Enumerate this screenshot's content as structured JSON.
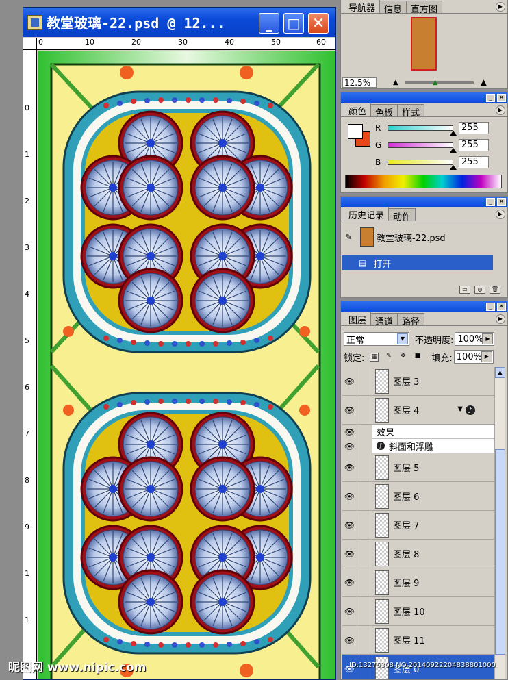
{
  "document": {
    "title": "教堂玻璃-22.psd @ 12...",
    "buttons": {
      "minimize": "_",
      "maximize": "□",
      "close": "✕"
    },
    "ruler_h": [
      "0",
      "10",
      "20",
      "30",
      "40",
      "50",
      "60"
    ],
    "ruler_v": [
      "0",
      "1",
      "2",
      "3",
      "4",
      "5",
      "6",
      "7",
      "8",
      "9",
      "1",
      "1"
    ]
  },
  "navigator": {
    "tabs": [
      "导航器",
      "信息",
      "直方图"
    ],
    "zoom": "12.5%"
  },
  "color": {
    "tabs": [
      "颜色",
      "色板",
      "样式"
    ],
    "channels": [
      {
        "label": "R",
        "value": "255",
        "color": "#30d0d0"
      },
      {
        "label": "G",
        "value": "255",
        "color": "#d030d0"
      },
      {
        "label": "B",
        "value": "255",
        "color": "#e8e820"
      }
    ],
    "foreground": "#ffffff",
    "background": "#e84818"
  },
  "history": {
    "tabs": [
      "历史记录",
      "动作"
    ],
    "snapshot": "教堂玻璃-22.psd",
    "items": [
      "打开"
    ]
  },
  "layers": {
    "tabs": [
      "图层",
      "通道",
      "路径"
    ],
    "blend_mode": "正常",
    "opacity_label": "不透明度:",
    "opacity": "100%",
    "lock_label": "锁定:",
    "fill_label": "填充:",
    "fill": "100%",
    "list": [
      {
        "name": "图层 3"
      },
      {
        "name": "图层 4",
        "has_fx": true
      },
      {
        "name": "效果",
        "effect_header": true
      },
      {
        "name": "斜面和浮雕",
        "effect": true
      },
      {
        "name": "图层 5"
      },
      {
        "name": "图层 6"
      },
      {
        "name": "图层 7"
      },
      {
        "name": "图层 8"
      },
      {
        "name": "图层 9"
      },
      {
        "name": "图层 10"
      },
      {
        "name": "图层 11"
      },
      {
        "name": "图层 0",
        "selected": true
      }
    ]
  },
  "watermark": {
    "text": "昵图网 www.nipic.com",
    "id": "ID:13276308 NO:20140922204838801000"
  }
}
